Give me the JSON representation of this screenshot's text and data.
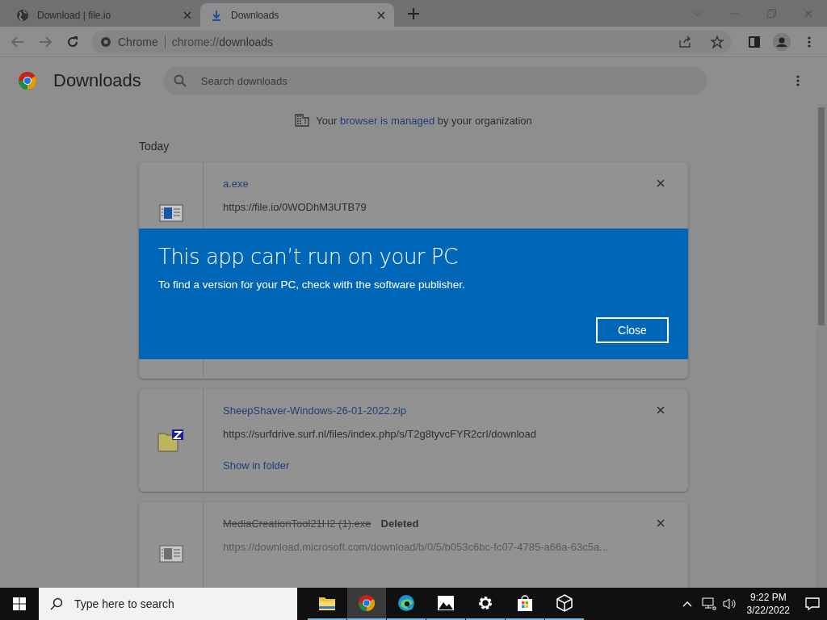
{
  "browser": {
    "tabs": [
      {
        "title": "Download | file.io",
        "kind": "web",
        "selected": false
      },
      {
        "title": "Downloads",
        "kind": "download",
        "selected": true
      }
    ],
    "omnibox": {
      "chip": "Chrome",
      "url_prefix": "chrome://",
      "url_path": "downloads"
    }
  },
  "page": {
    "title": "Downloads",
    "search": {
      "placeholder": "Search downloads"
    },
    "managed_notice": {
      "before": "Your",
      "link": "browser is managed",
      "after": "by your organization"
    },
    "section": "Today",
    "downloads": [
      {
        "kind": "exe",
        "name": "a.exe",
        "url": "https://file.io/0WODhM3UTB79",
        "deleted": false,
        "tall": true
      },
      {
        "kind": "zip",
        "name": "SheepShaver-Windows-26-01-2022.zip",
        "url": "https://surfdrive.surf.nl/files/index.php/s/T2g8tyvcFYR2crI/download",
        "action": "Show in folder",
        "deleted": false,
        "tall": false
      },
      {
        "kind": "exe",
        "name": "MediaCreationTool21H2 (1).exe",
        "status": "Deleted",
        "url": "https://download.microsoft.com/download/b/0/5/b053c6bc-fc07-4785-a66a-63c5a...",
        "deleted": true,
        "tall": false
      }
    ]
  },
  "dialog": {
    "title": "This app can’t run on your PC",
    "message": "To find a version for your PC, check with the software publisher.",
    "button": "Close"
  },
  "taskbar": {
    "search_placeholder": "Type here to search",
    "apps": [
      {
        "kind": "explorer",
        "selected": false
      },
      {
        "kind": "chrome",
        "selected": true
      },
      {
        "kind": "edge",
        "selected": false
      },
      {
        "kind": "photos",
        "selected": false
      },
      {
        "kind": "settings",
        "selected": false
      },
      {
        "kind": "store",
        "selected": false
      },
      {
        "kind": "cube",
        "selected": false
      }
    ],
    "time": "9:22 PM",
    "date": "3/22/2022"
  }
}
